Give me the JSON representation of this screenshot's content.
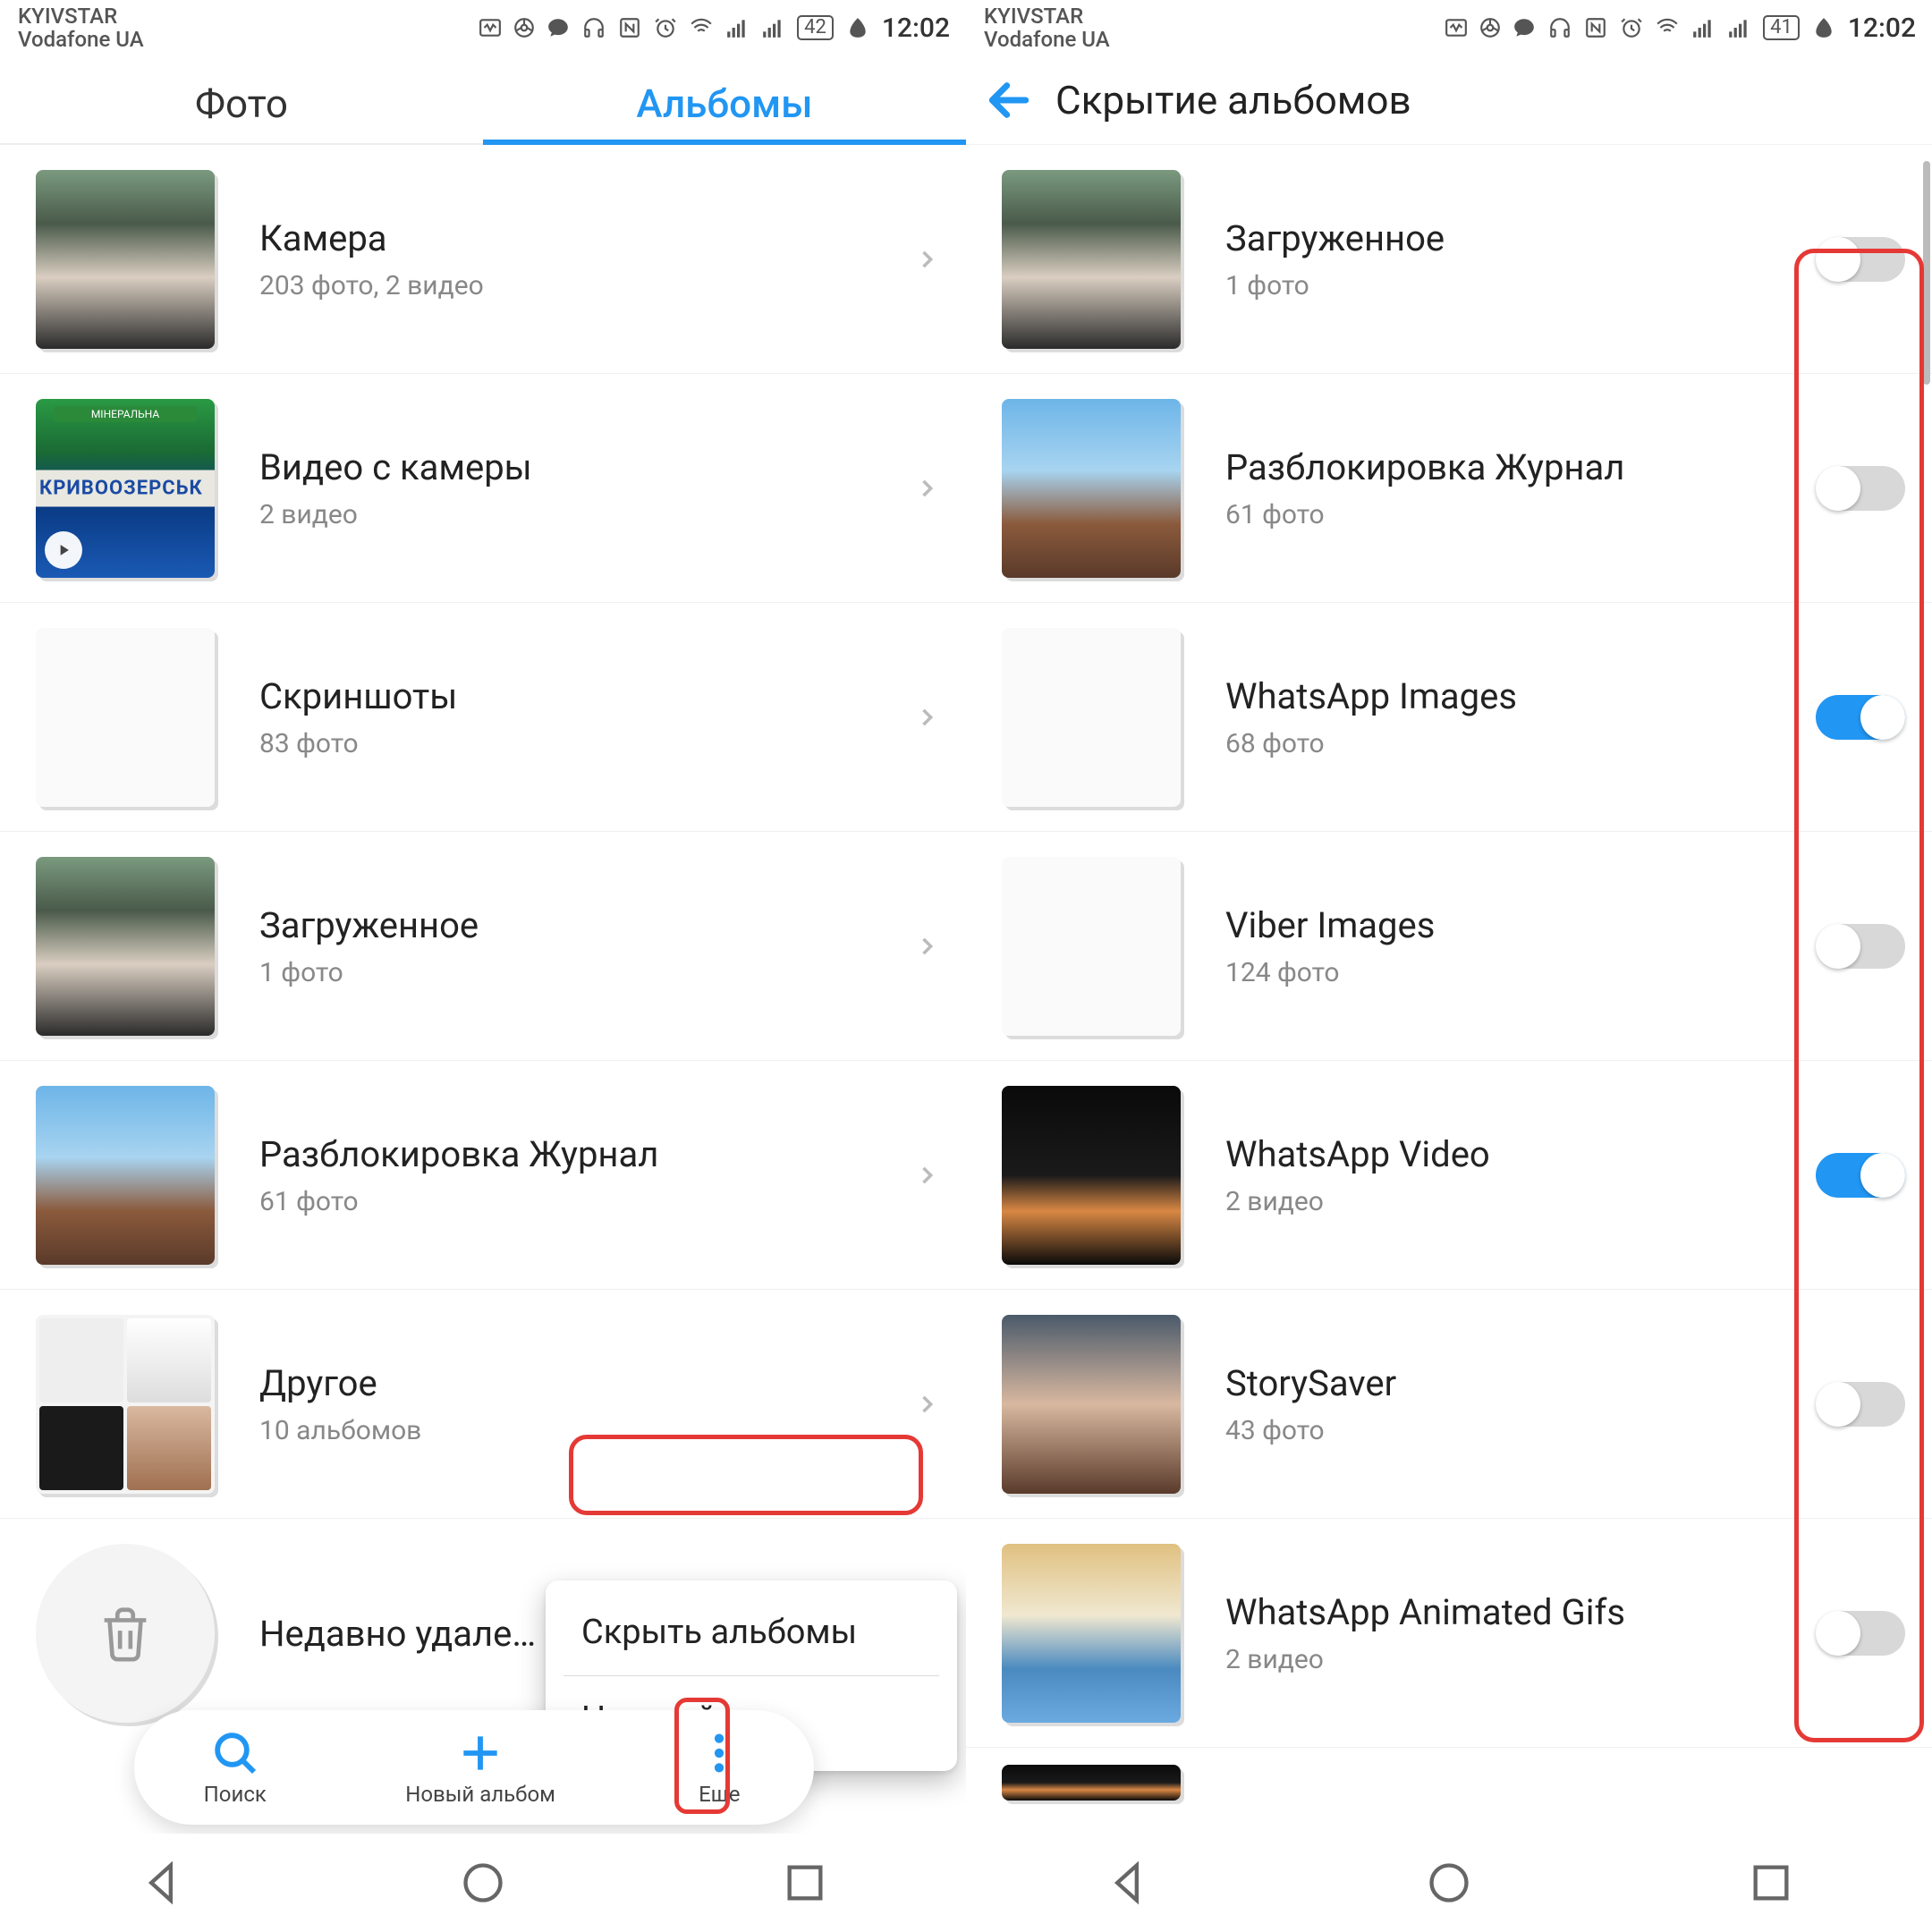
{
  "left": {
    "carrier1": "KYIVSTAR",
    "carrier2": "Vodafone UA",
    "battery": "42",
    "time": "12:02",
    "tabs": {
      "photos": "Фото",
      "albums": "Альбомы"
    },
    "rows": [
      {
        "title": "Камера",
        "sub": "203 фото,  2 видео"
      },
      {
        "title": "Видео с камеры",
        "sub": "2 видео"
      },
      {
        "title": "Скриншоты",
        "sub": "83 фото"
      },
      {
        "title": "Загруженное",
        "sub": "1 фото"
      },
      {
        "title": "Разблокировка Журнал",
        "sub": "61 фото"
      },
      {
        "title": "Другое",
        "sub": "10 альбомов"
      },
      {
        "title": "Недавно удале…",
        "sub": ""
      }
    ],
    "toolbar": {
      "search": "Поиск",
      "new_album": "Новый альбом",
      "more": "Еще"
    },
    "popup": {
      "hide": "Скрыть альбомы",
      "settings": "Настройки"
    }
  },
  "right": {
    "carrier1": "KYIVSTAR",
    "carrier2": "Vodafone UA",
    "battery": "41",
    "time": "12:02",
    "title": "Скрытие альбомов",
    "rows": [
      {
        "title": "Загруженное",
        "sub": "1 фото",
        "on": false
      },
      {
        "title": "Разблокировка Журнал",
        "sub": "61 фото",
        "on": false
      },
      {
        "title": "WhatsApp Images",
        "sub": "68 фото",
        "on": true
      },
      {
        "title": "Viber Images",
        "sub": "124 фото",
        "on": false
      },
      {
        "title": "WhatsApp Video",
        "sub": "2 видео",
        "on": true
      },
      {
        "title": "StorySaver",
        "sub": "43 фото",
        "on": false
      },
      {
        "title": "WhatsApp Animated Gifs",
        "sub": "2 видео",
        "on": false
      }
    ]
  }
}
